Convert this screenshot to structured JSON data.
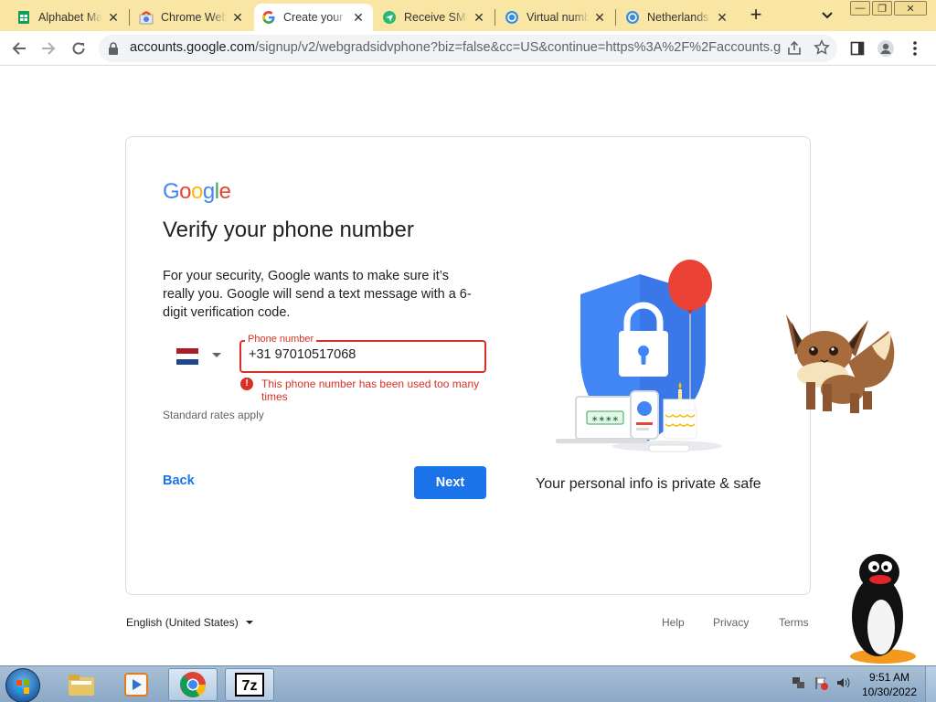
{
  "browser": {
    "tabs": [
      {
        "title": "Alphabet Ma",
        "icon": "sheets-icon",
        "active": false
      },
      {
        "title": "Chrome Web",
        "icon": "chrome-web-store-icon",
        "active": false
      },
      {
        "title": "Create your",
        "icon": "google-g-icon",
        "active": true
      },
      {
        "title": "Receive SMS",
        "icon": "sms-icon",
        "active": false
      },
      {
        "title": "Virtual numb",
        "icon": "chat-bubble-icon",
        "active": false
      },
      {
        "title": "Netherlands",
        "icon": "chat-bubble-icon",
        "active": false
      }
    ],
    "url_main": "accounts.google.com",
    "url_rest": "/signup/v2/webgradsidvphone?biz=false&cc=US&continue=https%3A%2F%2Faccounts.go..."
  },
  "page": {
    "logo": [
      "G",
      "o",
      "o",
      "g",
      "l",
      "e"
    ],
    "heading": "Verify your phone number",
    "description": "For your security, Google wants to make sure it’s really you. Google will send a text message with a 6-digit verification code.",
    "phone_label": "Phone number",
    "phone_value": "+31 97010517068",
    "error_text": "This phone number has been used too many times",
    "rates_text": "Standard rates apply",
    "back_label": "Back",
    "next_label": "Next",
    "privacy_text": "Your personal info is private & safe"
  },
  "footer": {
    "language": "English (United States)",
    "links": [
      "Help",
      "Privacy",
      "Terms"
    ]
  },
  "taskbar": {
    "time": "9:51 AM",
    "date": "10/30/2022"
  },
  "colors": {
    "tab_strip": "#f9e6a4",
    "google_blue": "#1a73e8",
    "error_red": "#d93025",
    "flag": [
      "#ae1c28",
      "#ffffff",
      "#21468b"
    ]
  }
}
